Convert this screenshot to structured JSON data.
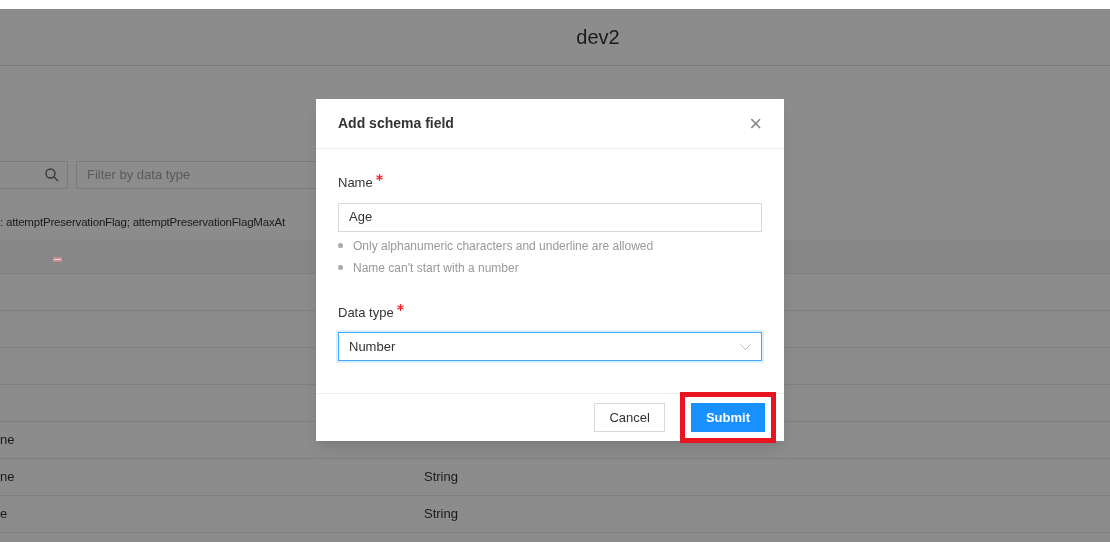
{
  "page": {
    "title": "dev2",
    "filter_placeholder": "Filter by data type",
    "info_text": ": attemptPreservationFlag; attemptPreservationFlagMaxAt"
  },
  "table": {
    "rows": [
      {
        "column_1": "",
        "column_2": ""
      },
      {
        "column_1": "",
        "column_2": ""
      },
      {
        "column_1": "",
        "column_2": ""
      },
      {
        "column_1": "",
        "column_2": ""
      },
      {
        "column_1": "ne",
        "column_2": ""
      },
      {
        "column_1": "ne",
        "column_2": "String"
      },
      {
        "column_1": "e",
        "column_2": "String"
      }
    ]
  },
  "dialog": {
    "title": "Add schema field",
    "close": "×",
    "fields": [
      {
        "kind": "text",
        "label": "Name",
        "required": true,
        "value": "Age",
        "focused": false,
        "hints": [
          "Only alphanumeric characters and underline are allowed",
          "Name can't start with a number"
        ]
      },
      {
        "kind": "select",
        "label": "Data type",
        "required": true,
        "value": "Number",
        "focused": true
      }
    ],
    "buttons": [
      {
        "label": "Cancel",
        "kind": "default",
        "highlighted": false
      },
      {
        "label": "Submit",
        "kind": "primary",
        "highlighted": true
      }
    ]
  }
}
